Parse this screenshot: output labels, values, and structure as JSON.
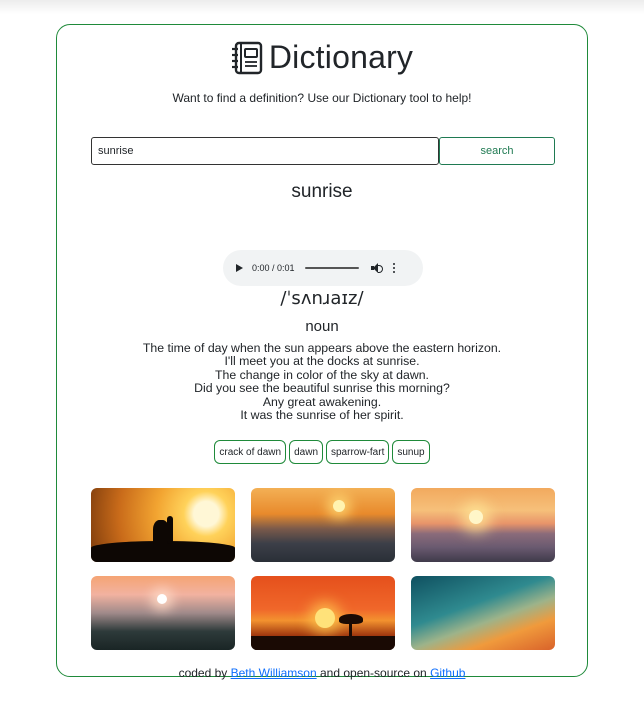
{
  "app": {
    "title": "Dictionary",
    "tagline": "Want to find a definition? Use our Dictionary tool to help!"
  },
  "search": {
    "value": "sunrise",
    "button_label": "search"
  },
  "result": {
    "word": "sunrise",
    "audio": {
      "time": "0:00 / 0:01"
    },
    "phonetic": "/ˈsʌnɹaɪz/",
    "part_of_speech": "noun",
    "definitions": [
      "The time of day when the sun appears above the eastern horizon.",
      "I'll meet you at the docks at sunrise.",
      "The change in color of the sky at dawn.",
      "Did you see the beautiful sunrise this morning?",
      "Any great awakening.",
      "It was the sunrise of her spirit."
    ],
    "synonyms": [
      "crack of dawn",
      "dawn",
      "sparrow-fart",
      "sunup"
    ]
  },
  "footer": {
    "prefix": "coded by",
    "author": "Beth Williamson",
    "middle": "and open-source on",
    "repo": "Github"
  },
  "colors": {
    "accent_border": "#1f8a3a",
    "link": "#0d6efd"
  }
}
